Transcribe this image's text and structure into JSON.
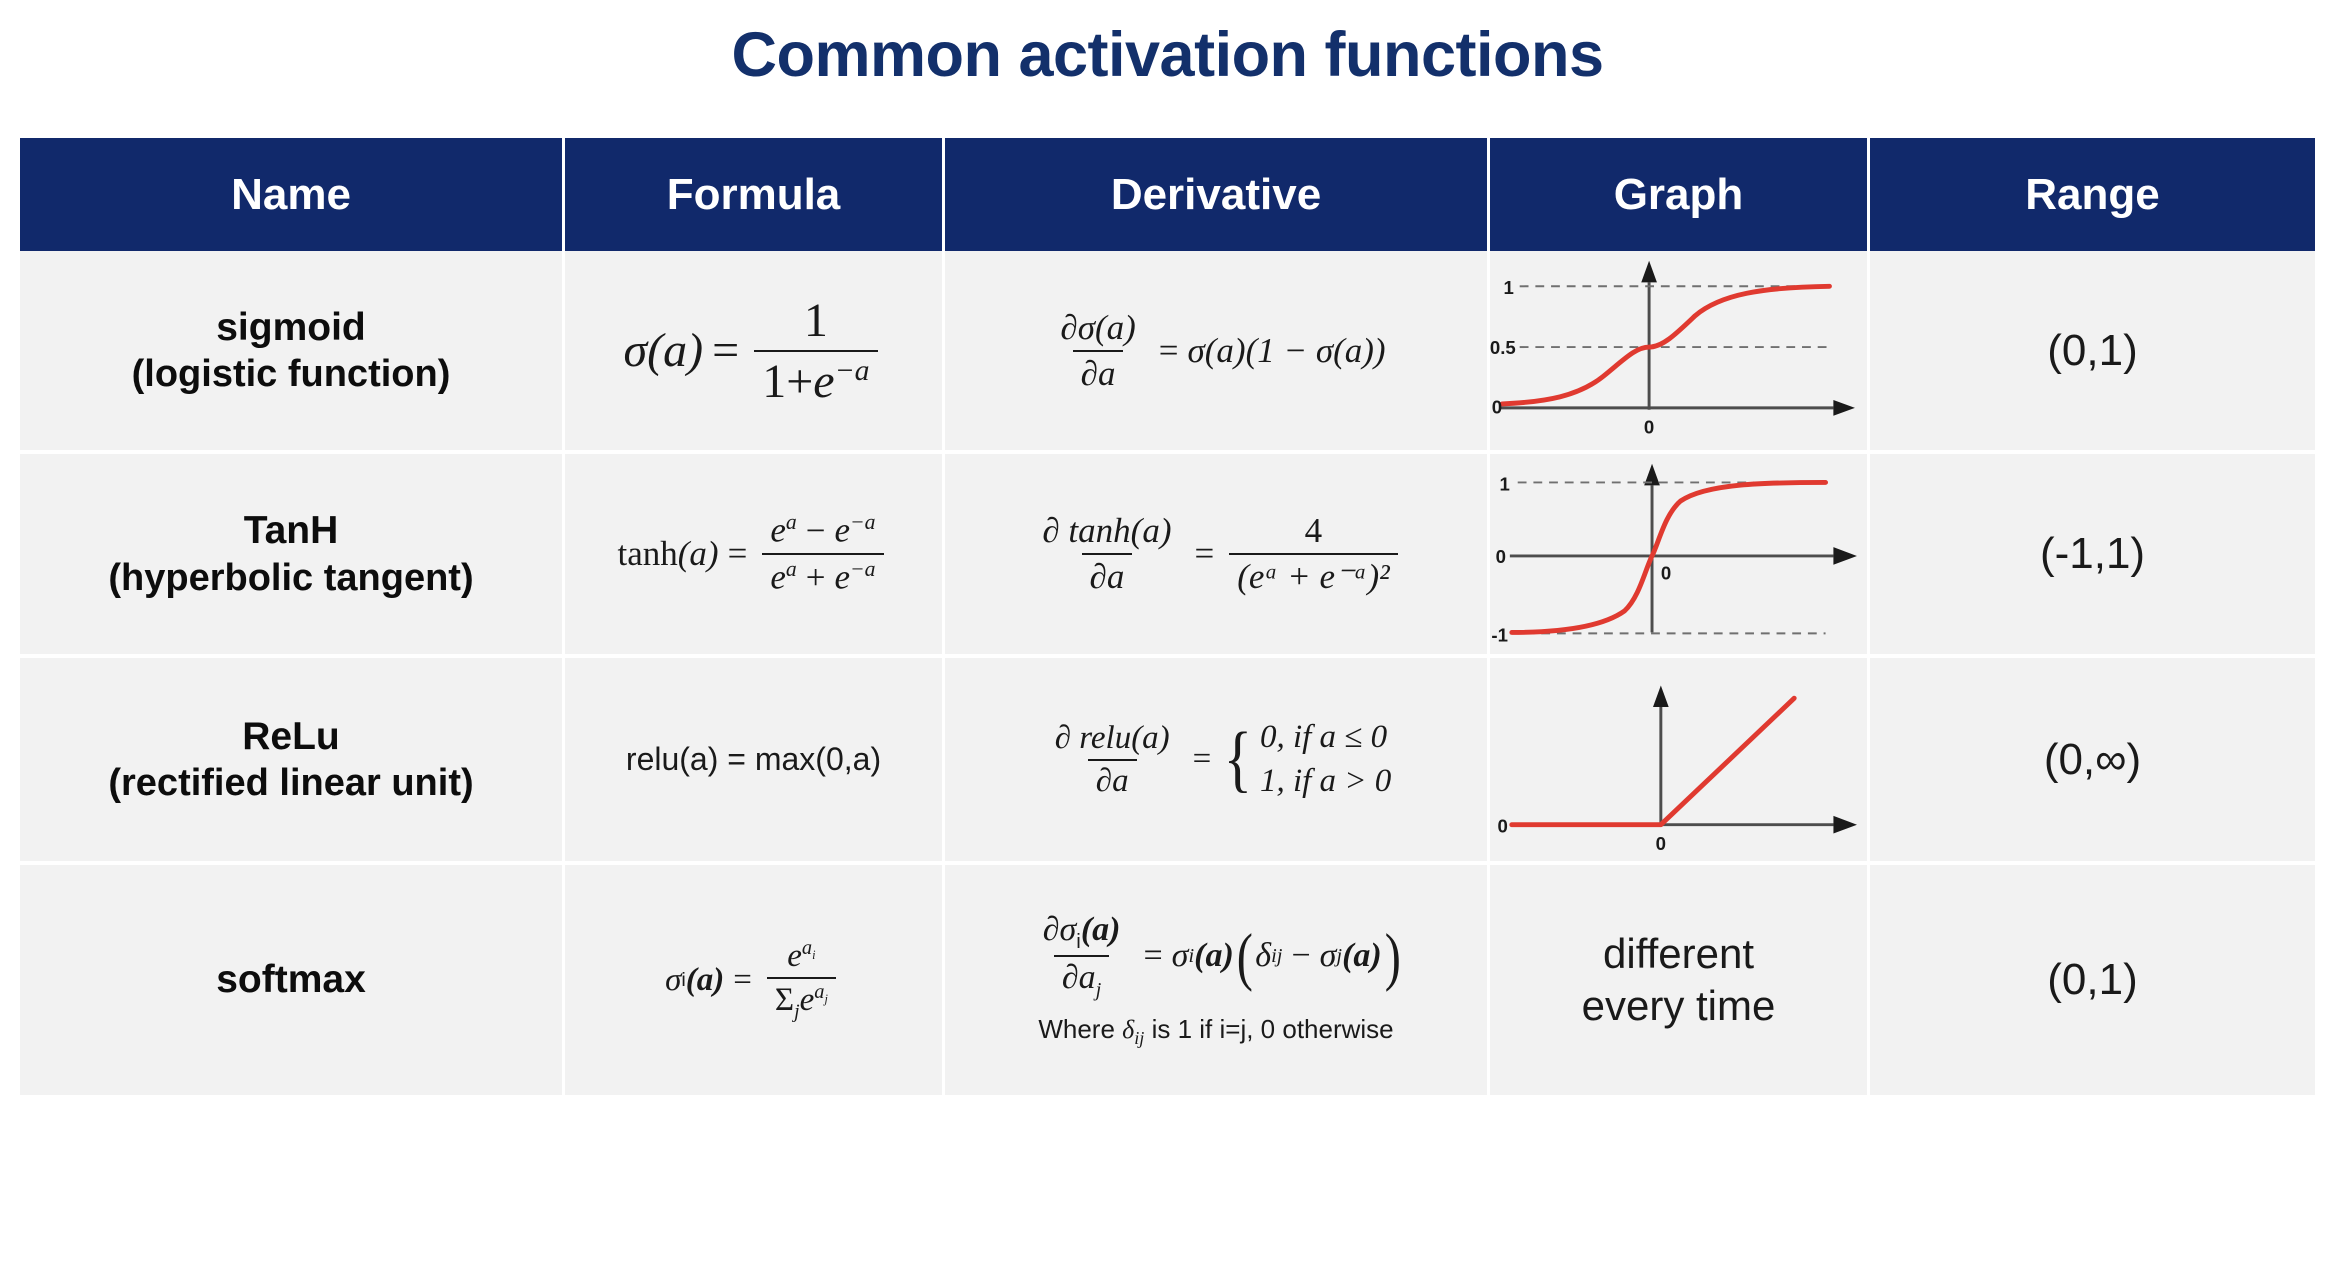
{
  "title": "Common activation functions",
  "theme": {
    "header_bg": "#11296b",
    "title_color": "#13306b",
    "row_bg": "#f2f2f2",
    "curve_color": "#e03a30",
    "axis_color": "#4d4d4d"
  },
  "table": {
    "columns": [
      {
        "key": "name",
        "label": "Name"
      },
      {
        "key": "formula",
        "label": "Formula"
      },
      {
        "key": "derivative",
        "label": "Derivative"
      },
      {
        "key": "graph",
        "label": "Graph"
      },
      {
        "key": "range",
        "label": "Range"
      }
    ],
    "rows": [
      {
        "name_line1": "sigmoid",
        "name_line2": "(logistic function)",
        "formula_text": "σ(a) = 1 / (1 + e^−a)",
        "derivative_text": "∂σ(a)/∂a = σ(a)(1 − σ(a))",
        "range": "(0,1)",
        "graph_type": "sigmoid",
        "graph_y_labels": [
          "1",
          "0.5",
          "0"
        ],
        "graph_x_label": "0"
      },
      {
        "name_line1": "TanH",
        "name_line2": "(hyperbolic tangent)",
        "formula_text": "tanh(a) = (e^a − e^−a) / (e^a + e^−a)",
        "derivative_text": "∂ tanh(a)/∂a = 4 / (e^a + e^−a)²",
        "range": "(-1,1)",
        "graph_type": "tanh",
        "graph_y_labels": [
          "1",
          "0",
          "-1"
        ],
        "graph_x_label": "0"
      },
      {
        "name_line1": "ReLu",
        "name_line2": "(rectified linear unit)",
        "formula_text": "relu(a) = max(0,a)",
        "derivative_text": "∂ relu(a)/∂a = { 0, if a ≤ 0 ; 1, if a > 0 }",
        "range": "(0,∞)",
        "graph_type": "relu",
        "graph_y_labels": [
          "0"
        ],
        "graph_x_label": "0"
      },
      {
        "name_line1": "softmax",
        "name_line2": "",
        "formula_text": "σi(a) = e^ai / Σj e^aj",
        "derivative_text": "∂σi(a)/∂aj = σi(a)(δij − σj(a))",
        "derivative_note": "Where δij is 1 if i=j, 0 otherwise",
        "range": "(0,1)",
        "graph_type": "text",
        "graph_text_line1": "different",
        "graph_text_line2": "every time"
      }
    ]
  },
  "math": {
    "sigmoid": {
      "lhs_sigma": "σ",
      "lhs_arg": "(a)",
      "eq": "=",
      "num": "1",
      "den_one": "1+",
      "den_e": "e",
      "den_exp": "−a"
    },
    "sigmoid_deriv": {
      "d": "∂",
      "sigma": "σ",
      "arg": "(a)",
      "den": "∂a",
      "eq": "=",
      "rhs": "σ(a)(1 − σ(a))"
    },
    "tanh": {
      "lhs": "tanh",
      "arg": "(a)",
      "eq": "=",
      "num_e1": "e",
      "num_sup1": "a",
      "num_minus": "−",
      "num_e2": "e",
      "num_sup2": "−a",
      "den_e1": "e",
      "den_sup1": "a",
      "den_plus": "+",
      "den_e2": "e",
      "den_sup2": "−a"
    },
    "tanh_deriv": {
      "num": "∂ tanh(a)",
      "den": "∂a",
      "eq": "=",
      "rnum": "4",
      "rden": "(eᵃ + e⁻ᵃ)²"
    },
    "relu": {
      "text": "relu(a) = max(0,a)"
    },
    "relu_deriv": {
      "num": "∂ relu(a)",
      "den": "∂a",
      "eq": "=",
      "case1": "0, if a ≤ 0",
      "case2": "1, if a > 0"
    },
    "softmax": {
      "sigma": "σ",
      "sub_i": "i",
      "arg": "(a)",
      "eq": "=",
      "num_e": "e",
      "num_sup": "a",
      "num_sup_sub": "i",
      "den_sum": "Σ",
      "den_sum_sub": "j",
      "den_e": "e",
      "den_sup": "a",
      "den_sup_sub": "j"
    },
    "softmax_deriv": {
      "num": "∂σ",
      "num_sub": "i",
      "num_arg": "(a)",
      "den": "∂a",
      "den_sub": "j",
      "eq": "=",
      "r1": "σ",
      "r1s": "i",
      "r1a": "(a)",
      "lp": "(",
      "delta": "δ",
      "delta_sub": "ij",
      "minus": "−",
      "r2": "σ",
      "r2s": "j",
      "r2a": "(a)",
      "rp": ")",
      "note_pre": "Where ",
      "note_delta": "δ",
      "note_delta_sub": "ij",
      "note_post": " is 1 if i=j, 0 otherwise"
    }
  }
}
